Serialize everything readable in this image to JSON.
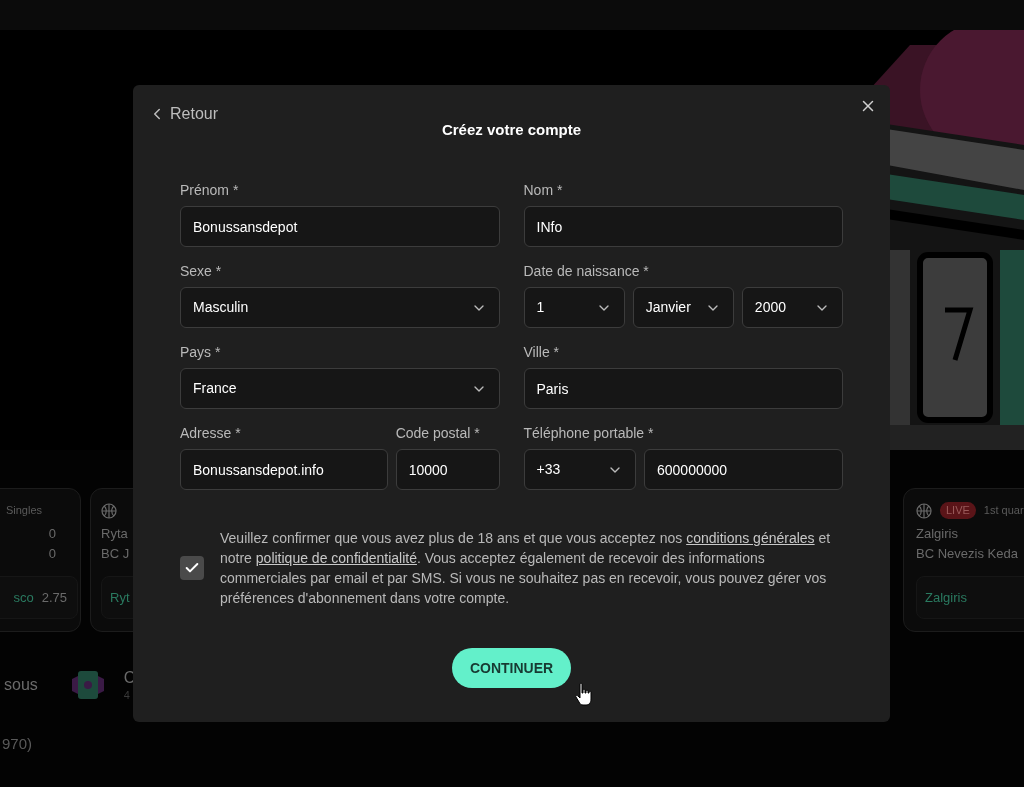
{
  "background": {
    "cards": [
      {
        "kind": "left",
        "header": "Singles",
        "lines": [
          "0",
          "0"
        ],
        "odds_team": "sco",
        "odds_value": "2.75"
      },
      {
        "kind": "middle",
        "lines": [
          "Ryta",
          "BC J"
        ],
        "odds_team": "Ryt"
      },
      {
        "kind": "right",
        "live": "LIVE",
        "header": "1st quar",
        "lines": [
          "Zalgiris",
          "BC Nevezis Keda"
        ],
        "odds_team": "Zalgiris"
      }
    ],
    "section_text": "sous",
    "game": {
      "title": "C",
      "subtitle": "4"
    },
    "footer_text": "970)"
  },
  "dialog": {
    "back": "Retour",
    "title": "Créez votre compte",
    "rows": [
      {
        "left": [
          {
            "label": "Prénom *",
            "inputs": [
              {
                "kind": "text",
                "value": "Bonussansdepot"
              }
            ]
          }
        ],
        "right": [
          {
            "label": "Nom *",
            "inputs": [
              {
                "kind": "text",
                "value": "INfo"
              }
            ]
          }
        ]
      },
      {
        "left": [
          {
            "label": "Sexe *",
            "inputs": [
              {
                "kind": "select",
                "value": "Masculin"
              }
            ]
          }
        ],
        "right": [
          {
            "label": "Date de naissance *",
            "inputs": [
              {
                "kind": "select",
                "value": "1"
              },
              {
                "kind": "select",
                "value": "Janvier"
              },
              {
                "kind": "select",
                "value": "2000"
              }
            ]
          }
        ]
      },
      {
        "left": [
          {
            "label": "Pays *",
            "inputs": [
              {
                "kind": "select",
                "value": "France"
              }
            ]
          }
        ],
        "right": [
          {
            "label": "Ville *",
            "inputs": [
              {
                "kind": "text",
                "value": "Paris"
              }
            ]
          }
        ]
      },
      {
        "left": [
          {
            "label": "Adresse *",
            "inputs": [
              {
                "kind": "text",
                "value": "Bonussansdepot.info"
              }
            ]
          },
          {
            "label": "Code postal *",
            "inputs": [
              {
                "kind": "text",
                "value": "10000"
              }
            ]
          }
        ],
        "right": [
          {
            "label": "Téléphone portable *",
            "inputs": [
              {
                "kind": "select",
                "value": "+33"
              },
              {
                "kind": "text",
                "value": "600000000"
              }
            ]
          }
        ]
      }
    ],
    "consent": {
      "checked": true,
      "parts": [
        {
          "kind": "text",
          "text": "Veuillez confirmer que vous avez plus de 18 ans et que vous acceptez nos "
        },
        {
          "kind": "link",
          "text": "conditions générales"
        },
        {
          "kind": "text",
          "text": " et notre "
        },
        {
          "kind": "link",
          "text": "politique de confidentialité"
        },
        {
          "kind": "text",
          "text": ". Vous acceptez également de recevoir des informations commerciales par email et par SMS. Si vous ne souhaitez pas en recevoir, vous pouvez gérer vos préférences d'abonnement dans votre compte."
        }
      ]
    },
    "continue": "CONTINUER"
  }
}
